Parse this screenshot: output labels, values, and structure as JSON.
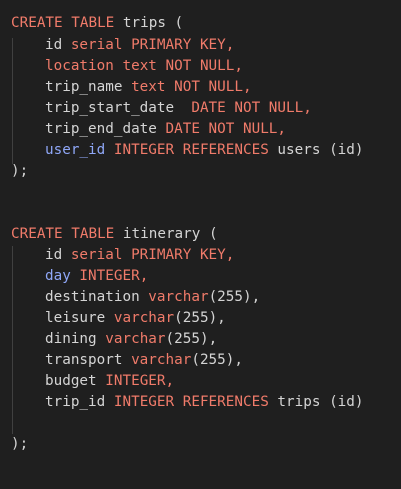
{
  "colors": {
    "background": "#1f1f1f",
    "keyword": "#f07b6a",
    "plain": "#d4d4d4",
    "identifier": "#8fa7f7",
    "indent_guide": "#404040"
  },
  "trips": {
    "create": "CREATE TABLE",
    "table_name": " trips (",
    "id_col": "id",
    "id_type": " serial PRIMARY KEY,",
    "location_col": "location",
    "location_type": " text NOT NULL,",
    "trip_name_col": "trip_name",
    "trip_name_type": " text NOT NULL,",
    "start_col": "trip_start_date",
    "start_type": "  DATE NOT NULL,",
    "end_col": "trip_end_date",
    "end_type": " DATE NOT NULL,",
    "user_col": "user_id",
    "user_type": " INTEGER REFERENCES",
    "user_ref": " users (id)",
    "close": ");"
  },
  "itinerary": {
    "create": "CREATE TABLE",
    "table_name": " itinerary (",
    "id_col": "id",
    "id_type": " serial PRIMARY KEY,",
    "day_col": "day",
    "day_type": " INTEGER,",
    "destination_col": "destination",
    "destination_type": " varchar",
    "destination_size": "(255),",
    "leisure_col": "leisure",
    "leisure_type": " varchar",
    "leisure_size": "(255),",
    "dining_col": "dining",
    "dining_type": " varchar",
    "dining_size": "(255),",
    "transport_col": "transport",
    "transport_type": " varchar",
    "transport_size": "(255),",
    "budget_col": "budget",
    "budget_type": " INTEGER,",
    "trip_col": "trip_id",
    "trip_type": " INTEGER REFERENCES",
    "trip_ref": " trips (id)",
    "close": ");"
  }
}
